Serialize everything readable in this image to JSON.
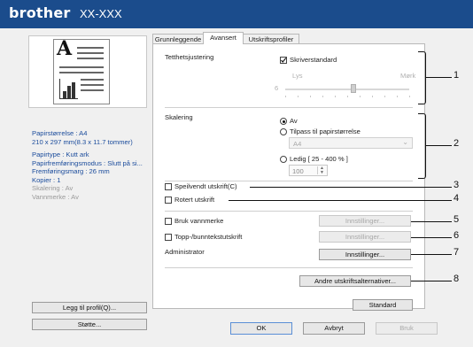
{
  "titlebar": {
    "brand": "brother",
    "model": "XX-XXX"
  },
  "preview": {
    "letter": "A"
  },
  "summary": [
    {
      "text": "Papirstørrelse : A4",
      "muted": false
    },
    {
      "text": "210 x 297 mm(8.3 x 11.7 tommer)",
      "muted": false
    },
    {
      "text": "",
      "muted": false
    },
    {
      "text": "Papirtype : Kutt ark",
      "muted": false
    },
    {
      "text": "Papirfremføringsmodus : Slutt på si...",
      "muted": false
    },
    {
      "text": "Fremføringsmarg : 26 mm",
      "muted": false
    },
    {
      "text": "Kopier : 1",
      "muted": false
    },
    {
      "text": "Skalering : Av",
      "muted": true
    },
    {
      "text": "Vannmerke : Av",
      "muted": true
    }
  ],
  "left_buttons": {
    "add_profile": "Legg til profil(Q)...",
    "support": "Støtte..."
  },
  "tabs": [
    "Grunnleggende",
    "Avansert",
    "Utskriftsprofiler"
  ],
  "density": {
    "label": "Tetthetsjustering",
    "printer_default_label": "Skriverstandard",
    "printer_default_checked": true,
    "light_label": "Lys",
    "dark_label": "Mørk",
    "value": "6",
    "slider_level": 0.55
  },
  "scaling": {
    "label": "Skalering",
    "options": [
      "Av",
      "Tilpass til papirstørrelse",
      "Ledig [ 25 - 400 % ]"
    ],
    "selected": "Av",
    "paper_size_value": "A4",
    "percent_value": "100"
  },
  "checkboxes": {
    "mirror": "Speilvendt utskrift(C)",
    "rotate": "Rotert utskrift",
    "watermark": "Bruk vannmerke",
    "header_footer": "Topp-/bunntekstutskrift"
  },
  "settings_buttons": {
    "watermark": "Innstillinger...",
    "header_footer": "Innstillinger...",
    "admin": "Innstillinger..."
  },
  "admin_label": "Administrator",
  "other_print_options": "Andre utskriftsalternativer...",
  "standard_button": "Standard",
  "footer_buttons": {
    "ok": "OK",
    "cancel": "Avbryt",
    "apply": "Bruk"
  },
  "callouts": [
    "1",
    "2",
    "3",
    "4",
    "5",
    "6",
    "7",
    "8"
  ]
}
